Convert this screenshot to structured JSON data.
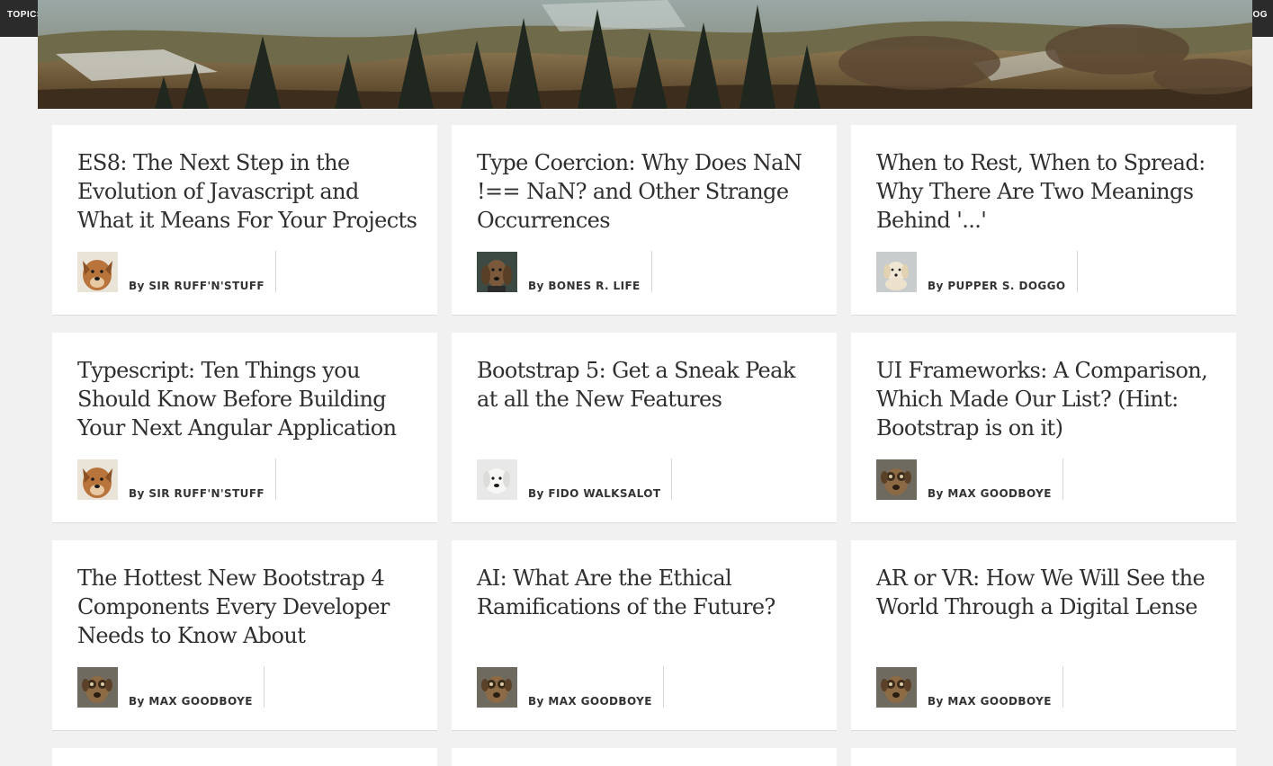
{
  "topbar": {
    "left_label": "TOPICS",
    "right_label": "BLOG"
  },
  "hero": {
    "image_alt": "forest-hills-landscape"
  },
  "posts": [
    {
      "title": "ES8: The Next Step in the Evolution of Javascript and What it Means For Your Projects",
      "byline": "By SIR RUFF'N'STUFF",
      "avatar": "dog-ruff"
    },
    {
      "title": "Type Coercion: Why Does NaN !== NaN? and Other Strange Occurrences",
      "byline": "By BONES R. LIFE",
      "avatar": "dog-bones"
    },
    {
      "title": "When to Rest, When to Spread: Why There Are Two Meanings Behind '...'",
      "byline": "By PUPPER S. DOGGO",
      "avatar": "dog-pupper"
    },
    {
      "title": "Typescript: Ten Things you Should Know Before Building Your Next Angular Application",
      "byline": "By SIR RUFF'N'STUFF",
      "avatar": "dog-ruff"
    },
    {
      "title": "Bootstrap 5: Get a Sneak Peak at all the New Features",
      "byline": "By FIDO WALKSALOT",
      "avatar": "dog-fido"
    },
    {
      "title": "UI Frameworks: A Comparison, Which Made Our List? (Hint: Bootstrap is on it)",
      "byline": "By MAX GOODBOYE",
      "avatar": "dog-max"
    },
    {
      "title": "The Hottest New Bootstrap 4 Components Every Developer Needs to Know About",
      "byline": "By MAX GOODBOYE",
      "avatar": "dog-max"
    },
    {
      "title": "AI: What Are the Ethical Ramifications of the Future?",
      "byline": "By MAX GOODBOYE",
      "avatar": "dog-max"
    },
    {
      "title": "AR or VR: How We Will See the World Through a Digital Lense",
      "byline": "By MAX GOODBOYE",
      "avatar": "dog-max"
    }
  ],
  "colors": {
    "page_background": "#f1f1f1",
    "card_background": "#ffffff",
    "title_text": "#2f2f2f",
    "topbar": "#2b2b2b"
  }
}
